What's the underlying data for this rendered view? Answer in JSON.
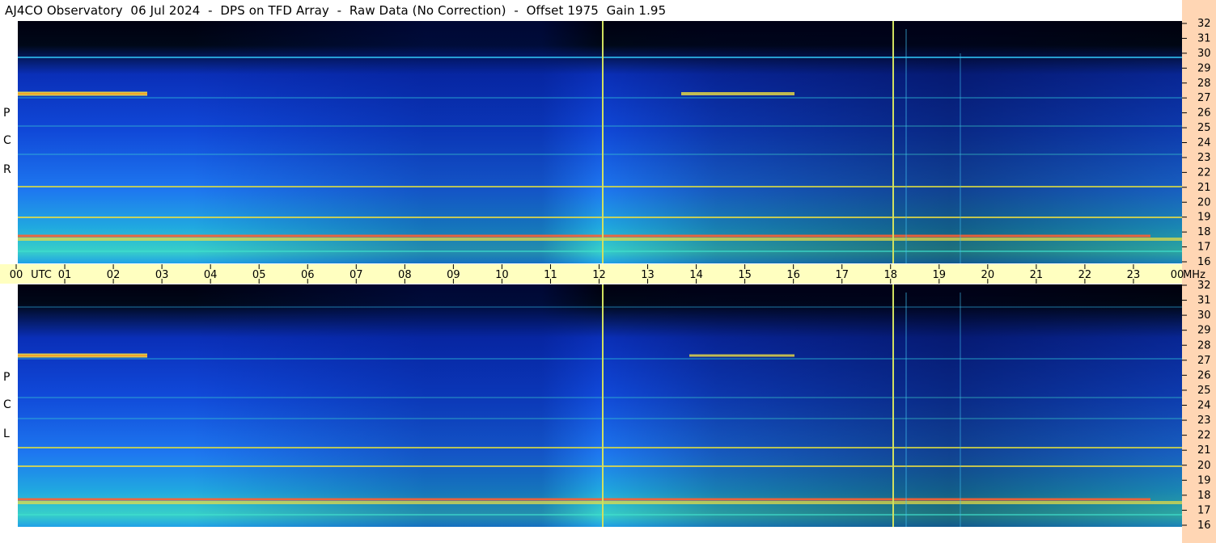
{
  "page": {
    "title": "AJ4CO Observatory  06 Jul 2024  -  DPS on TFD Array  -  Raw Data (No Correction)  -  Offset 1975  Gain 1.95"
  },
  "panels": [
    {
      "id": "rcp",
      "letters": [
        "R",
        "C",
        "P"
      ]
    },
    {
      "id": "lcp",
      "letters": [
        "L",
        "C",
        "P"
      ]
    }
  ],
  "chart_data": {
    "type": "heatmap",
    "title": "AJ4CO Observatory  06 Jul 2024  -  DPS on TFD Array  -  Raw Data (No Correction)  -  Offset 1975  Gain 1.95",
    "x_ticks": [
      "00",
      "UTC",
      "01",
      "02",
      "03",
      "04",
      "05",
      "06",
      "07",
      "08",
      "09",
      "10",
      "11",
      "12",
      "13",
      "14",
      "15",
      "16",
      "17",
      "18",
      "19",
      "20",
      "21",
      "22",
      "23",
      "00",
      "MHz"
    ],
    "x_range_utc_hours": [
      0,
      24
    ],
    "y_ticks": [
      "32",
      "31",
      "30",
      "29",
      "28",
      "27",
      "26",
      "25",
      "24",
      "23",
      "22",
      "21",
      "20",
      "19",
      "18",
      "17",
      "16"
    ],
    "y_range_mhz": [
      16,
      32
    ],
    "panels": [
      "RCP",
      "LCP"
    ],
    "colors": {
      "background_low": "#000010",
      "low": "#0a2fb8",
      "mid": "#1e78f0",
      "high": "#20c8d8",
      "peak": "#f0e040",
      "max": "#ff3020",
      "time_axis_bg": "#ffffc0",
      "freq_axis_bg": "#ffd6b4"
    }
  }
}
